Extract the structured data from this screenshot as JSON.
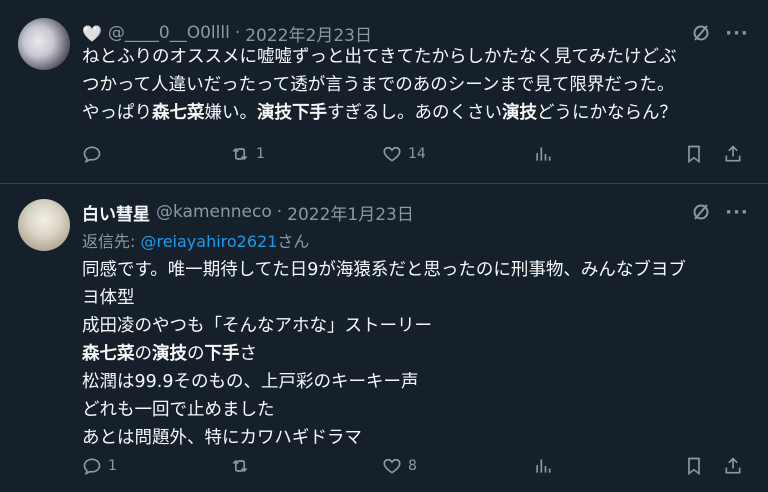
{
  "tweets": [
    {
      "display_name": "",
      "handle": "@____0__O0llll",
      "date": "2022年2月23日",
      "lines": [
        "ねとふりのオススメに嘘嘘ずっと出てきてたからしかたなく見てみたけどぶ",
        "つかって人違いだったって透が言うまでのあのシーンまで見て限界だった。"
      ],
      "line3": {
        "a": "やっぱり",
        "b": "森七菜",
        "c": "嫌い。",
        "d": "演技下手",
        "e": "すぎるし。あのくさい",
        "f": "演技",
        "g": "どうにかならん？"
      },
      "reply_count": "",
      "retweet_count": "1",
      "like_count": "14"
    },
    {
      "display_name": "白い彗星",
      "handle": "@kamenneco",
      "date": "2022年1月23日",
      "reply_label": "返信先: ",
      "reply_mention": "@reiayahiro2621",
      "reply_suffix": "さん",
      "lines": [
        "同感です。唯一期待してた日9が海猿系だと思ったのに刑事物、みんなブヨブ",
        "ヨ体型",
        "成田凌のやつも「そんなアホな」ストーリー"
      ],
      "line4": {
        "a": "森七菜",
        "b": "の",
        "c": "演技",
        "d": "の",
        "e": "下手",
        "f": "さ"
      },
      "lines_after": [
        "松潤は99.9そのもの、上戸彩のキーキー声",
        "どれも一回で止めました",
        "あとは問題外、特にカワハギドラマ"
      ],
      "reply_count": "1",
      "retweet_count": "",
      "like_count": "8"
    }
  ],
  "colors": {
    "background": "#15202b",
    "text": "#f7f9f9",
    "secondary": "#8b98a5",
    "link": "#1d9bf0",
    "divider": "#38444d"
  },
  "icons": [
    "heart-icon",
    "grok-icon",
    "more-icon",
    "reply-icon",
    "retweet-icon",
    "like-icon",
    "views-icon",
    "bookmark-icon",
    "share-icon"
  ]
}
